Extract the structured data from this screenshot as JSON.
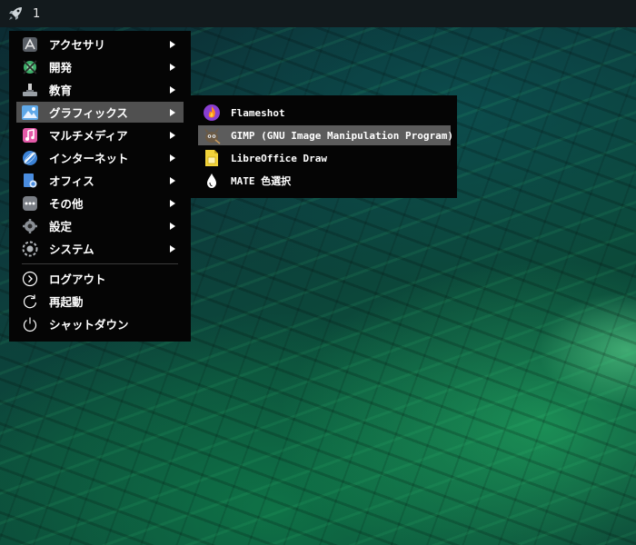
{
  "panel": {
    "workspace_number": "1",
    "launcher_icon": "rocket-icon"
  },
  "menu": {
    "items": [
      {
        "label": "アクセサリ",
        "icon": "accessories-icon",
        "has_submenu": true
      },
      {
        "label": "開発",
        "icon": "development-icon",
        "has_submenu": true
      },
      {
        "label": "教育",
        "icon": "education-icon",
        "has_submenu": true
      },
      {
        "label": "グラフィックス",
        "icon": "graphics-icon",
        "has_submenu": true,
        "selected": true
      },
      {
        "label": "マルチメディア",
        "icon": "multimedia-icon",
        "has_submenu": true
      },
      {
        "label": "インターネット",
        "icon": "internet-icon",
        "has_submenu": true
      },
      {
        "label": "オフィス",
        "icon": "office-icon",
        "has_submenu": true
      },
      {
        "label": "その他",
        "icon": "other-icon",
        "has_submenu": true
      },
      {
        "label": "設定",
        "icon": "settings-icon",
        "has_submenu": true
      },
      {
        "label": "システム",
        "icon": "system-icon",
        "has_submenu": true
      }
    ],
    "session": [
      {
        "label": "ログアウト",
        "icon": "logout-icon"
      },
      {
        "label": "再起動",
        "icon": "restart-icon"
      },
      {
        "label": "シャットダウン",
        "icon": "shutdown-icon"
      }
    ]
  },
  "submenu": {
    "items": [
      {
        "label": "Flameshot",
        "icon": "flameshot-icon"
      },
      {
        "label": "GIMP (GNU Image Manipulation Program)",
        "icon": "gimp-icon",
        "selected": true
      },
      {
        "label": "LibreOffice Draw",
        "icon": "libreoffice-draw-icon"
      },
      {
        "label": "MATE 色選択",
        "icon": "color-picker-icon"
      }
    ]
  },
  "colors": {
    "menu_background": "#050505",
    "selection": "#505050",
    "panel": "#131a1d"
  }
}
